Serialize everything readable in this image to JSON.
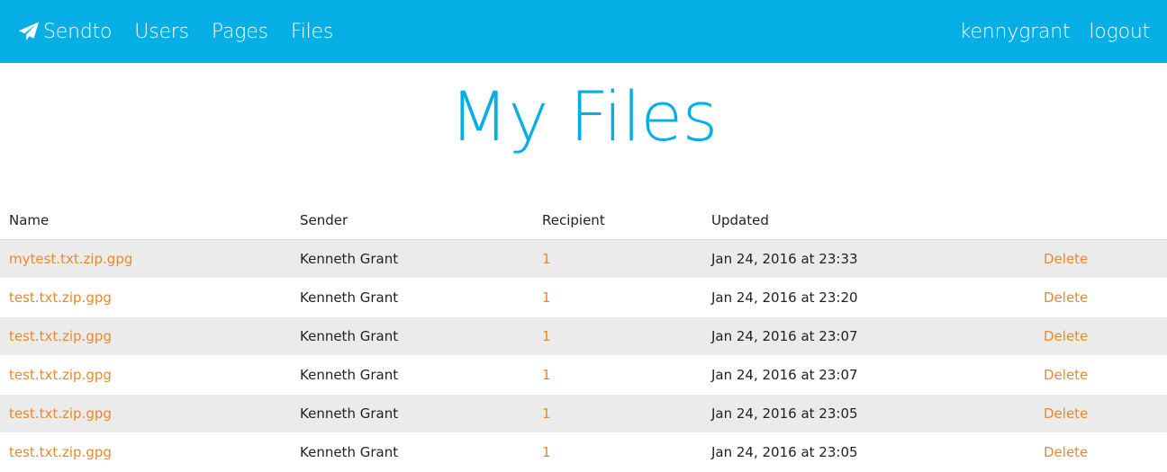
{
  "nav": {
    "brand_label": "Sendto",
    "brand_icon": "paper-plane-icon",
    "items": [
      {
        "label": "Users"
      },
      {
        "label": "Pages"
      },
      {
        "label": "Files"
      }
    ],
    "username": "kennygrant",
    "logout_label": "logout"
  },
  "page": {
    "title": "My Files"
  },
  "table": {
    "headers": {
      "name": "Name",
      "sender": "Sender",
      "recipient": "Recipient",
      "updated": "Updated",
      "actions": ""
    },
    "rows": [
      {
        "name": "mytest.txt.zip.gpg",
        "sender": "Kenneth Grant",
        "recipient": "1",
        "updated": "Jan 24, 2016 at 23:33",
        "action": "Delete"
      },
      {
        "name": "test.txt.zip.gpg",
        "sender": "Kenneth Grant",
        "recipient": "1",
        "updated": "Jan 24, 2016 at 23:20",
        "action": "Delete"
      },
      {
        "name": "test.txt.zip.gpg",
        "sender": "Kenneth Grant",
        "recipient": "1",
        "updated": "Jan 24, 2016 at 23:07",
        "action": "Delete"
      },
      {
        "name": "test.txt.zip.gpg",
        "sender": "Kenneth Grant",
        "recipient": "1",
        "updated": "Jan 24, 2016 at 23:07",
        "action": "Delete"
      },
      {
        "name": "test.txt.zip.gpg",
        "sender": "Kenneth Grant",
        "recipient": "1",
        "updated": "Jan 24, 2016 at 23:05",
        "action": "Delete"
      },
      {
        "name": "test.txt.zip.gpg",
        "sender": "Kenneth Grant",
        "recipient": "1",
        "updated": "Jan 24, 2016 at 23:05",
        "action": "Delete"
      }
    ]
  },
  "colors": {
    "primary": "#06aee6",
    "link": "#e8892d",
    "row_stripe": "#ebebeb"
  }
}
